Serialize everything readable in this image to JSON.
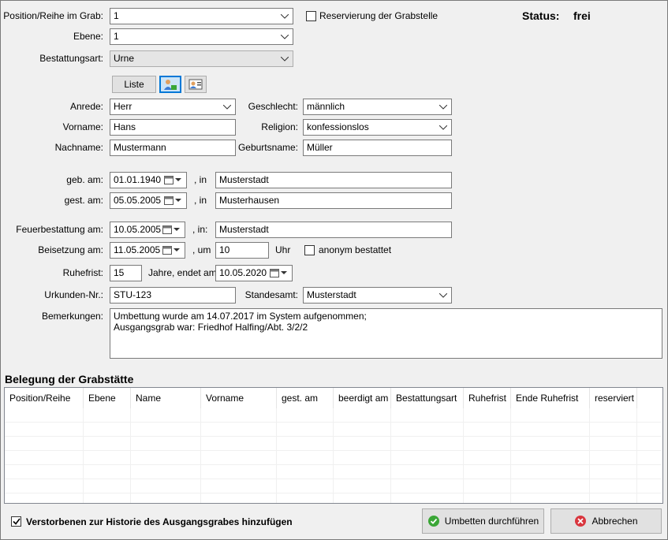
{
  "form": {
    "position_label": "Position/Reihe im Grab:",
    "position_value": "1",
    "reservation_label": "Reservierung der Grabstelle",
    "reservation_checked": false,
    "status_label": "Status:",
    "status_value": "frei",
    "ebene_label": "Ebene:",
    "ebene_value": "1",
    "bestattungsart_label": "Bestattungsart:",
    "bestattungsart_value": "Urne",
    "liste_label": "Liste",
    "anrede_label": "Anrede:",
    "anrede_value": "Herr",
    "geschlecht_label": "Geschlecht:",
    "geschlecht_value": "männlich",
    "vorname_label": "Vorname:",
    "vorname_value": "Hans",
    "religion_label": "Religion:",
    "religion_value": "konfessionslos",
    "nachname_label": "Nachname:",
    "nachname_value": "Mustermann",
    "geburtsname_label": "Geburtsname:",
    "geburtsname_value": "Müller",
    "geb_label": "geb. am:",
    "geb_value": "01.01.1940",
    "geb_in_label": ", in",
    "geb_ort": "Musterstadt",
    "gest_label": "gest. am:",
    "gest_value": "05.05.2005",
    "gest_in_label": ", in",
    "gest_ort": "Musterhausen",
    "feuer_label": "Feuerbestattung am:",
    "feuer_value": "10.05.2005",
    "feuer_in_label": ", in:",
    "feuer_ort": "Musterstadt",
    "beisetzung_label": "Beisetzung am:",
    "beisetzung_value": "11.05.2005",
    "um_label": ", um",
    "uhrzeit_value": "10",
    "uhr_label": "Uhr",
    "anonym_label": "anonym bestattet",
    "anonym_checked": false,
    "ruhefrist_label": "Ruhefrist:",
    "ruhefrist_value": "15",
    "jahre_label": "Jahre, endet am",
    "ruhefrist_ende": "10.05.2020",
    "urkunden_label": "Urkunden-Nr.:",
    "urkunden_value": "STU-123",
    "standesamt_label": "Standesamt:",
    "standesamt_value": "Musterstadt",
    "bemerkungen_label": "Bemerkungen:",
    "bemerkungen_line1": "Umbettung wurde am 14.07.2017 im System aufgenommen;",
    "bemerkungen_line2": "Ausgangsgrab war: Friedhof Halfing/Abt. 3/2/2"
  },
  "belegung": {
    "title": "Belegung der Grabstätte",
    "columns": [
      "Position/Reihe",
      "Ebene",
      "Name",
      "Vorname",
      "gest. am",
      "beerdigt am",
      "Bestattungsart",
      "Ruhefrist",
      "Ende Ruhefrist",
      "reserviert"
    ]
  },
  "footer": {
    "historie_label": "Verstorbenen zur Historie des Ausgangsgrabes hinzufügen",
    "historie_checked": true,
    "umbetten_label": "Umbetten durchführen",
    "abbrechen_label": "Abbrechen"
  },
  "colors": {
    "ok_green": "#3aa636",
    "cancel_red": "#d9363e",
    "accent_blue": "#0078d7"
  }
}
